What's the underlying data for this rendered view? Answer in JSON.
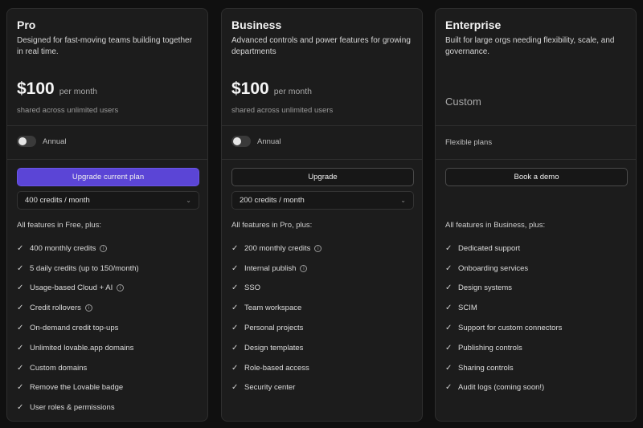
{
  "plans": {
    "pro": {
      "title": "Pro",
      "description": "Designed for fast-moving teams building together in real time.",
      "price": "$100",
      "period": "per month",
      "shared_note": "shared across unlimited users",
      "toggle_label": "Annual",
      "toggle_on": false,
      "cta_label": "Upgrade current plan",
      "credits_select_value": "400 credits / month",
      "features_heading": "All features in Free, plus:",
      "features": [
        {
          "label": "400 monthly credits",
          "info": true
        },
        {
          "label": "5 daily credits (up to 150/month)",
          "info": false
        },
        {
          "label": "Usage-based Cloud + AI",
          "info": true
        },
        {
          "label": "Credit rollovers",
          "info": true
        },
        {
          "label": "On-demand credit top-ups",
          "info": false
        },
        {
          "label": "Unlimited lovable.app domains",
          "info": false
        },
        {
          "label": "Custom domains",
          "info": false
        },
        {
          "label": "Remove the Lovable badge",
          "info": false
        },
        {
          "label": "User roles & permissions",
          "info": false
        }
      ]
    },
    "business": {
      "title": "Business",
      "description": "Advanced controls and power features for growing departments",
      "price": "$100",
      "period": "per month",
      "shared_note": "shared across unlimited users",
      "toggle_label": "Annual",
      "toggle_on": false,
      "cta_label": "Upgrade",
      "credits_select_value": "200 credits / month",
      "features_heading": "All features in Pro, plus:",
      "features": [
        {
          "label": "200 monthly credits",
          "info": true
        },
        {
          "label": "Internal publish",
          "info": true
        },
        {
          "label": "SSO",
          "info": false
        },
        {
          "label": "Team workspace",
          "info": false
        },
        {
          "label": "Personal projects",
          "info": false
        },
        {
          "label": "Design templates",
          "info": false
        },
        {
          "label": "Role-based access",
          "info": false
        },
        {
          "label": "Security center",
          "info": false
        }
      ]
    },
    "enterprise": {
      "title": "Enterprise",
      "description": "Built for large orgs needing flexibility, scale, and governance.",
      "price_text": "Custom",
      "flexible_label": "Flexible plans",
      "cta_label": "Book a demo",
      "features_heading": "All features in Business, plus:",
      "features": [
        {
          "label": "Dedicated support",
          "info": false
        },
        {
          "label": "Onboarding services",
          "info": false
        },
        {
          "label": "Design systems",
          "info": false
        },
        {
          "label": "SCIM",
          "info": false
        },
        {
          "label": "Support for custom connectors",
          "info": false
        },
        {
          "label": "Publishing controls",
          "info": false
        },
        {
          "label": "Sharing controls",
          "info": false
        },
        {
          "label": "Audit logs (coming soon!)",
          "info": false
        }
      ]
    }
  },
  "icons": {
    "check": "check-icon",
    "info": "info-icon",
    "chevron": "chevron-down-icon"
  },
  "colors": {
    "accent": "#5b45d6",
    "card_bg": "#1c1c1c",
    "page_bg": "#101010"
  }
}
